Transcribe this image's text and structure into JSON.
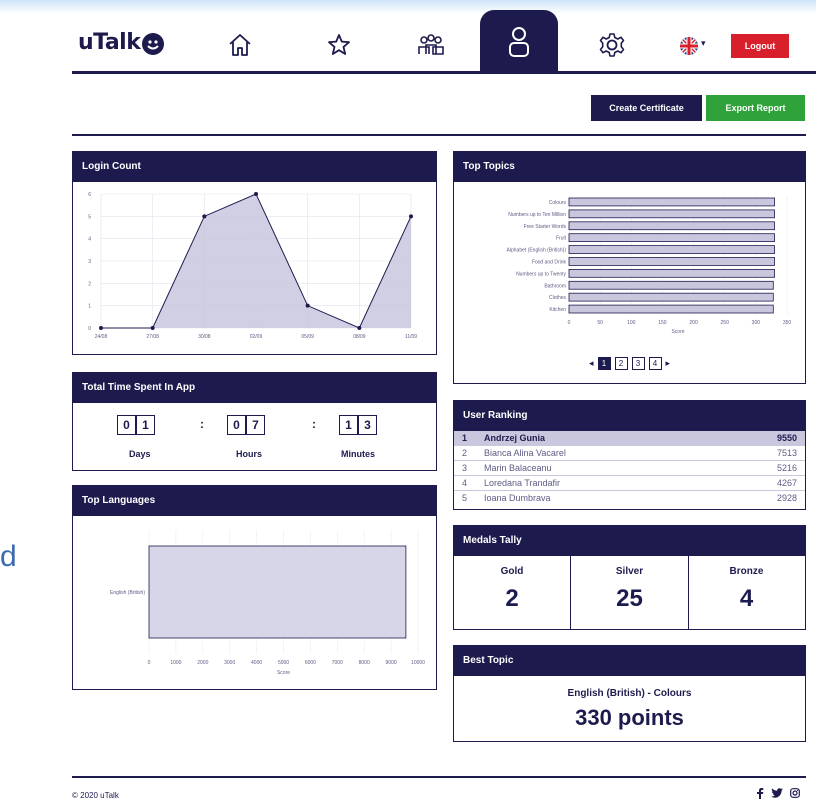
{
  "header": {
    "logo_text": "uTalk",
    "nav_items": [
      {
        "name": "home",
        "icon": "home-icon"
      },
      {
        "name": "favourites",
        "icon": "star-icon"
      },
      {
        "name": "groups",
        "icon": "group-icon"
      },
      {
        "name": "profile",
        "icon": "user-icon",
        "active": true
      },
      {
        "name": "settings",
        "icon": "gear-icon"
      }
    ],
    "language_icon": "uk-flag-icon",
    "logout_label": "Logout"
  },
  "actions": {
    "create_certificate": "Create Certificate",
    "export_report": "Export Report",
    "certificate_color": "#1d1b4e",
    "export_color": "#30a23a"
  },
  "login_count": {
    "title": "Login Count",
    "chart_data": {
      "type": "area",
      "x": [
        "24/08",
        "27/08",
        "30/08",
        "02/09",
        "05/09",
        "08/09",
        "11/09"
      ],
      "y": [
        0,
        0,
        5,
        6,
        1,
        0,
        5
      ],
      "y_ticks": [
        "0",
        "1",
        "2",
        "3",
        "4",
        "5",
        "6"
      ],
      "ylim": [
        0,
        6
      ],
      "grid": true,
      "fill_color": "#c9c7de",
      "line_color": "#1d1b4e"
    }
  },
  "time_spent": {
    "title": "Total Time Spent In App",
    "days": [
      "0",
      "1"
    ],
    "hours": [
      "0",
      "7"
    ],
    "minutes": [
      "1",
      "3"
    ],
    "separator": ":",
    "days_label": "Days",
    "hours_label": "Hours",
    "minutes_label": "Minutes"
  },
  "top_languages": {
    "title": "Top Languages",
    "chart_data": {
      "type": "bar",
      "orientation": "horizontal",
      "categories": [
        "English (British)"
      ],
      "values": [
        9550
      ],
      "xlim": [
        0,
        10000
      ],
      "x_ticks": [
        "0",
        "1000",
        "2000",
        "3000",
        "4000",
        "5000",
        "6000",
        "7000",
        "8000",
        "9000",
        "10000"
      ],
      "xlabel": "Score",
      "grid": true
    }
  },
  "top_topics": {
    "title": "Top Topics",
    "chart_data": {
      "type": "bar",
      "orientation": "horizontal",
      "categories": [
        "Colours",
        "Numbers up to Ten Million",
        "Free Starter Words",
        "Fruit",
        "Alphabet (English (British))",
        "Food and Drink",
        "Numbers up to Twenty",
        "Bathroom",
        "Clothes",
        "Kitchen"
      ],
      "values": [
        330,
        330,
        330,
        330,
        330,
        330,
        330,
        328,
        328,
        328
      ],
      "xlim": [
        0,
        350
      ],
      "x_ticks": [
        "0",
        "50",
        "100",
        "150",
        "200",
        "250",
        "300",
        "350"
      ],
      "xlabel": "Score",
      "grid": true
    },
    "pages": [
      "1",
      "2",
      "3",
      "4"
    ],
    "current_page": "1",
    "prev_icon": "chevron-left-icon",
    "next_icon": "chevron-right-icon"
  },
  "user_ranking": {
    "title": "User Ranking",
    "rows": [
      {
        "rank": "1",
        "name": "Andrzej Gunia",
        "score": "9550"
      },
      {
        "rank": "2",
        "name": "Bianca Alina Vacarel",
        "score": "7513"
      },
      {
        "rank": "3",
        "name": "Marin Balaceanu",
        "score": "5216"
      },
      {
        "rank": "4",
        "name": "Loredana Trandafir",
        "score": "4267"
      },
      {
        "rank": "5",
        "name": "Ioana Dumbrava",
        "score": "2928"
      }
    ]
  },
  "medals": {
    "title": "Medals Tally",
    "gold_label": "Gold",
    "gold": "2",
    "silver_label": "Silver",
    "silver": "25",
    "bronze_label": "Bronze",
    "bronze": "4"
  },
  "best_topic": {
    "title": "Best Topic",
    "topic": "English (British) - Colours",
    "points": "330 points"
  },
  "footer": {
    "copyright": "© 2020 uTalk",
    "social_icons": [
      "facebook-icon",
      "twitter-icon",
      "instagram-icon"
    ]
  },
  "side_fragment": "d"
}
